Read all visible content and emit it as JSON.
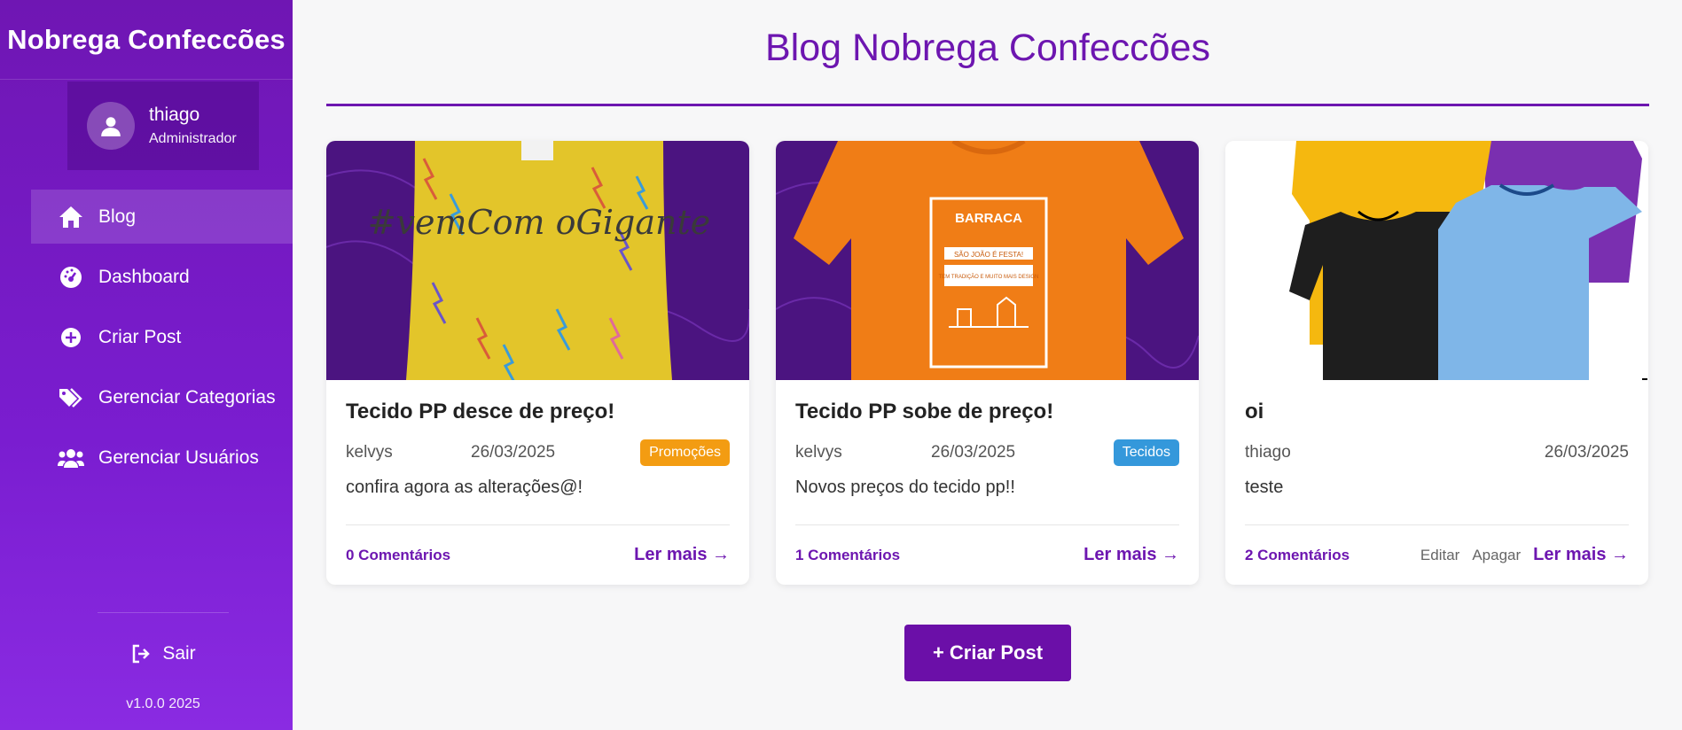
{
  "sidebar": {
    "brand": "Nobrega Confeccões",
    "user": {
      "name": "thiago",
      "role": "Administrador"
    },
    "items": [
      {
        "label": "Blog",
        "icon": "home-icon",
        "active": true
      },
      {
        "label": "Dashboard",
        "icon": "gauge-icon"
      },
      {
        "label": "Criar Post",
        "icon": "plus-circle-icon"
      },
      {
        "label": "Gerenciar Categorias",
        "icon": "tags-icon"
      },
      {
        "label": "Gerenciar Usuários",
        "icon": "users-icon"
      }
    ],
    "logout_label": "Sair",
    "version": "v1.0.0 2025"
  },
  "main": {
    "title": "Blog Nobrega Confeccões",
    "create_button": "+ Criar Post",
    "posts": [
      {
        "title": "Tecido PP desce de preço!",
        "author": "kelvys",
        "date": "26/03/2025",
        "category": "Promoções",
        "category_color": "#f39c12",
        "excerpt": "confira agora as alterações@!",
        "comments": "0 Comentários",
        "read_more": "Ler mais →"
      },
      {
        "title": "Tecido PP sobe de preço!",
        "author": "kelvys",
        "date": "26/03/2025",
        "category": "Tecidos",
        "category_color": "#3498db",
        "excerpt": "Novos preços do tecido pp!!",
        "comments": "1 Comentários",
        "read_more": "Ler mais →"
      },
      {
        "title": "oi",
        "author": "thiago",
        "date": "26/03/2025",
        "excerpt": "teste",
        "comments": "2 Comentários",
        "edit": "Editar",
        "delete": "Apagar",
        "read_more": "Ler mais →"
      }
    ],
    "image_texts": {
      "shirt1": "#vemCom oGigante",
      "shirt2_brand": "BARRACA",
      "shirt2_line1": "SÃO JOÃO É FESTA!",
      "shirt2_line2": "TEM TRADIÇÃO E MUITO MAIS DESIGN"
    }
  }
}
